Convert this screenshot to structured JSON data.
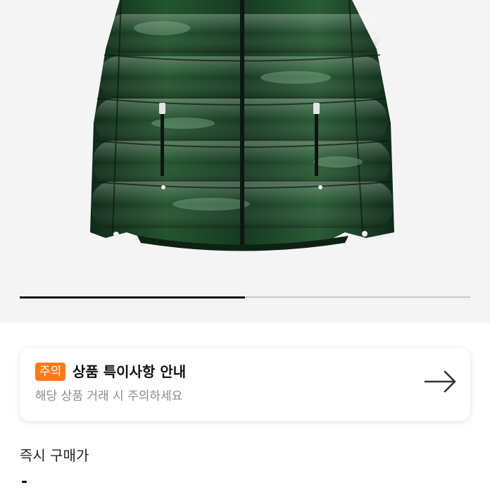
{
  "product_image": {
    "subject": "green-puffer-jacket",
    "colors": {
      "background": "#f4f4f4",
      "jacket": "#1f4a2c",
      "jacket_dark": "#0e2416",
      "highlight": "#6f9c7a"
    }
  },
  "gallery": {
    "progress_fraction": 0.5
  },
  "notice": {
    "badge": "주의",
    "title": "상품 특이사항 안내",
    "description": "해당 상품 거래 시 주의하세요",
    "arrow_icon": "arrow-right-icon",
    "badge_color": "#ff7a1a"
  },
  "purchase": {
    "label": "즉시 구매가",
    "value": "-"
  }
}
